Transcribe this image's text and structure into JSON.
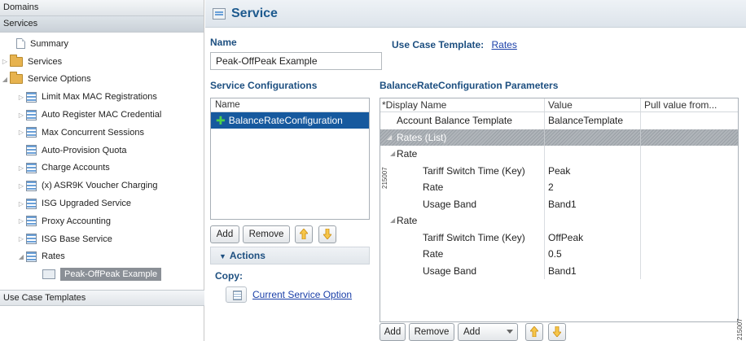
{
  "sidebar": {
    "domains_header": "Domains",
    "services_header": "Services",
    "tree": [
      {
        "label": "Summary",
        "icon": "page-icon"
      },
      {
        "label": "Services",
        "icon": "folder-icon"
      },
      {
        "label": "Service Options",
        "icon": "folder-icon"
      },
      {
        "label": "Limit Max MAC Registrations",
        "icon": "list-icon"
      },
      {
        "label": "Auto Register MAC Credential",
        "icon": "list-icon"
      },
      {
        "label": "Max Concurrent Sessions",
        "icon": "list-icon"
      },
      {
        "label": "Auto-Provision Quota",
        "icon": "list-icon"
      },
      {
        "label": "Charge Accounts",
        "icon": "list-icon"
      },
      {
        "label": "(x) ASR9K Voucher Charging",
        "icon": "list-icon"
      },
      {
        "label": "ISG Upgraded Service",
        "icon": "list-icon"
      },
      {
        "label": "Proxy Accounting",
        "icon": "list-icon"
      },
      {
        "label": "ISG Base Service",
        "icon": "list-icon"
      },
      {
        "label": "Rates",
        "icon": "list-icon"
      },
      {
        "label": "Peak-OffPeak Example",
        "icon": "service-icon"
      }
    ],
    "use_case_templates_header": "Use Case Templates"
  },
  "page": {
    "title": "Service",
    "name_label": "Name",
    "name_value": "Peak-OffPeak Example",
    "use_case_label": "Use Case Template:",
    "use_case_link": "Rates",
    "service_configurations_label": "Service Configurations",
    "config_table": {
      "header": "Name",
      "items": [
        "BalanceRateConfiguration"
      ]
    },
    "config_buttons": {
      "add": "Add",
      "remove": "Remove"
    },
    "actions_label": "Actions",
    "copy_label": "Copy:",
    "copy_link": "Current Service Option",
    "params_label": "BalanceRateConfiguration Parameters",
    "params_table": {
      "headers": [
        "*Display Name",
        "Value",
        "Pull value from..."
      ],
      "rows": [
        {
          "name": "Account Balance Template",
          "value": "BalanceTemplate"
        },
        {
          "name": "Rates (List)",
          "value": ""
        },
        {
          "name": "Rate",
          "value": ""
        },
        {
          "name": "Tariff Switch Time (Key)",
          "value": "Peak"
        },
        {
          "name": "Rate",
          "value": "2"
        },
        {
          "name": "Usage Band",
          "value": "Band1"
        },
        {
          "name": "Rate",
          "value": ""
        },
        {
          "name": "Tariff Switch Time (Key)",
          "value": "OffPeak"
        },
        {
          "name": "Rate",
          "value": "0.5"
        },
        {
          "name": "Usage Band",
          "value": "Band1"
        }
      ]
    },
    "params_buttons": {
      "add": "Add",
      "remove": "Remove",
      "add_select": "Add"
    },
    "figure_id_side": "215007",
    "figure_id_corner": "215007"
  },
  "colors": {
    "title": "#1d5a8e",
    "link": "#1a3fa8",
    "selected_row": "#16599e",
    "plus": "#4cd04c",
    "arrow": "#f0a020"
  }
}
